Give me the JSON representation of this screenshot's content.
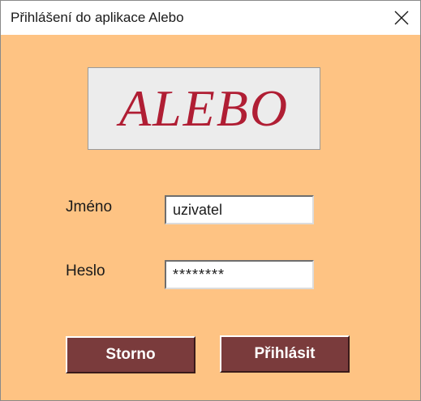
{
  "window": {
    "title": "Přihlášení do aplikace Alebo"
  },
  "logo": {
    "text": "ALEBO"
  },
  "form": {
    "name_label": "Jméno",
    "name_value": "uzivatel",
    "password_label": "Heslo",
    "password_value": "********"
  },
  "buttons": {
    "cancel_label": "Storno",
    "login_label": "Přihlásit"
  },
  "icons": {
    "close": "close-icon"
  },
  "colors": {
    "background": "#fec383",
    "button": "#7a3b3c",
    "logo_text": "#b01e34",
    "logo_box": "#ececec"
  }
}
